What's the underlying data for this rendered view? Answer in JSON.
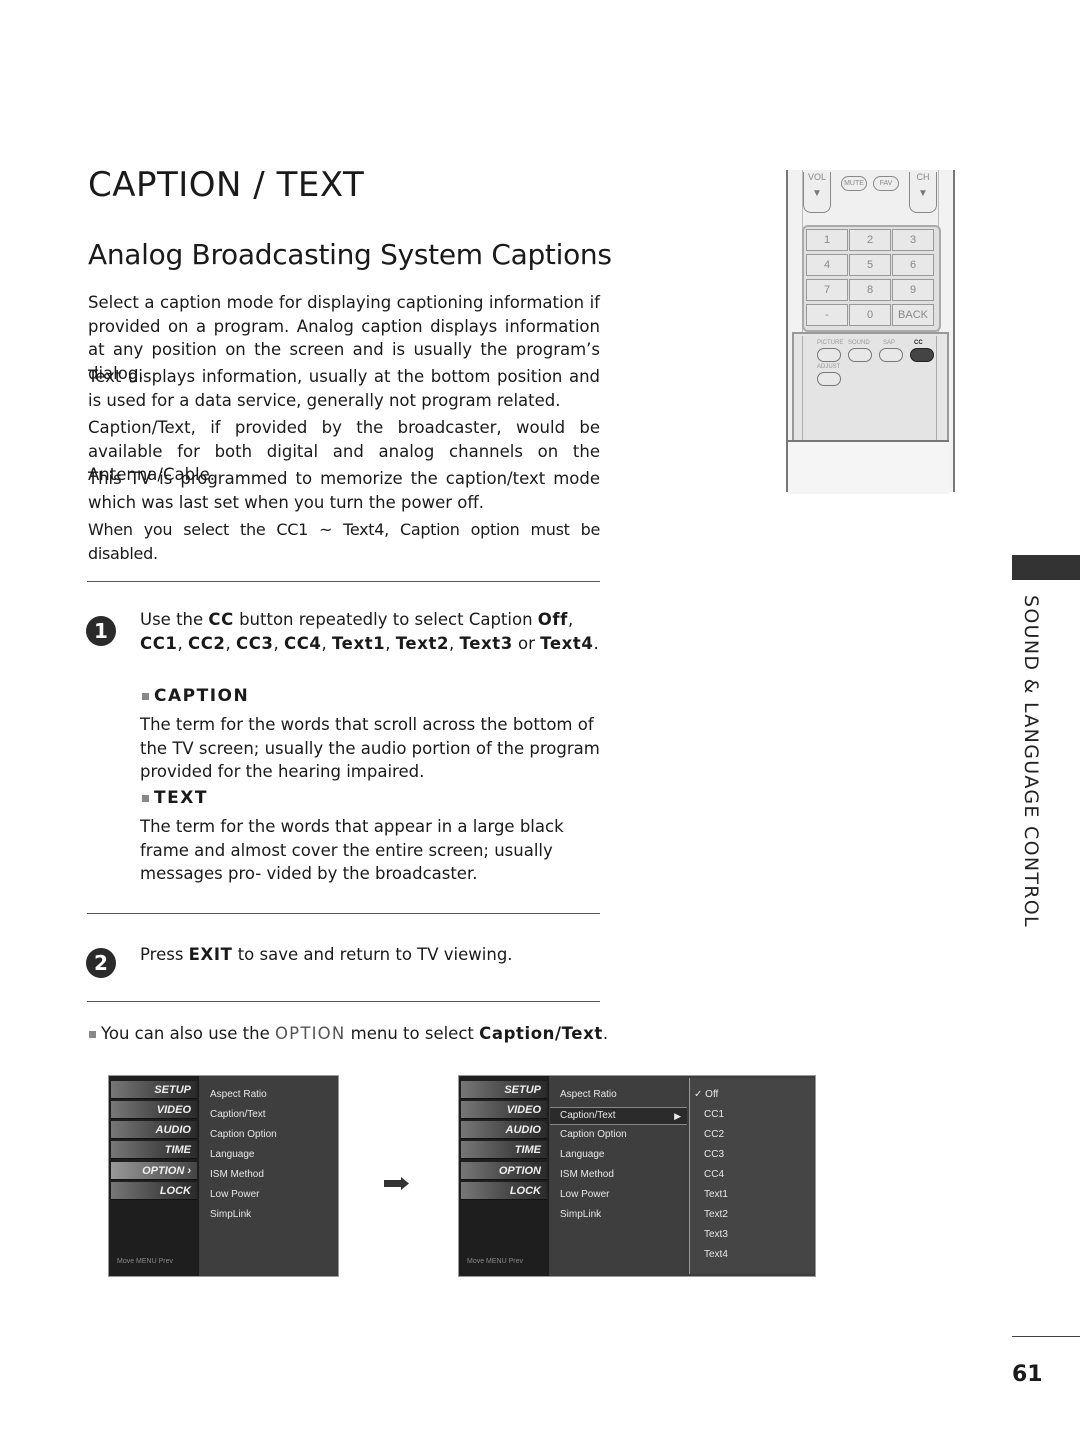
{
  "header": {
    "title": "CAPTION / TEXT",
    "subtitle": "Analog Broadcasting System Captions"
  },
  "intro": [
    "Select a caption mode for displaying captioning information if provided on a program. Analog caption displays information at any position on the screen and is usually the program’s dialog.",
    "Text displays information, usually at the bottom position and is used for a data service, generally not program related.",
    "Caption/Text, if provided by the broadcaster, would be available for both digital and analog channels on the Antenna/Cable.",
    "This TV is programmed to memorize the caption/text mode which was last set when you turn the power off.",
    "When you select the CC1 ~ Text4, Caption option must be disabled."
  ],
  "steps": [
    {
      "number": "1",
      "text_parts": [
        "Use the ",
        "CC",
        " button repeatedly to select Caption ",
        "Off",
        ", ",
        "CC1",
        ", ",
        "CC2",
        ", ",
        "CC3",
        ", ",
        "CC4",
        ", ",
        "Text1",
        ", ",
        "Text2",
        ", ",
        "Text3",
        " or ",
        "Text4",
        "."
      ],
      "subsections": [
        {
          "heading": "CAPTION",
          "body": "The term for the words that scroll across the bottom of the TV screen; usually the audio portion of the program provided for the hearing impaired."
        },
        {
          "heading": "TEXT",
          "body": "The term for the words that appear in a large black frame and almost cover the entire screen; usually messages pro- vided by the broadcaster."
        }
      ]
    },
    {
      "number": "2",
      "text_parts": [
        "Press ",
        "EXIT",
        " to save and return to TV viewing."
      ]
    }
  ],
  "note": {
    "parts": [
      "You can also use the ",
      "OPTION",
      " menu to select ",
      "Caption/Text",
      "."
    ]
  },
  "side_label": "SOUND & LANGUAGE CONTROL",
  "page_number": "61",
  "remote": {
    "top_buttons": [
      "VOL",
      "MUTE",
      "FAV",
      "CH"
    ],
    "keys": [
      "1",
      "2",
      "3",
      "4",
      "5",
      "6",
      "7",
      "8",
      "9",
      "-",
      "0",
      "BACK"
    ],
    "tray_buttons": [
      "PICTURE",
      "SOUND",
      "SAP",
      "CC",
      "ADJUST"
    ],
    "highlighted": "CC"
  },
  "osd": {
    "categories": [
      "SETUP",
      "VIDEO",
      "AUDIO",
      "TIME",
      "OPTION",
      "LOCK"
    ],
    "active_category": "OPTION",
    "footer": "Move   MENU Prev",
    "menu_items": [
      "Aspect Ratio",
      "Caption/Text",
      "Caption Option",
      "Language",
      "ISM Method",
      "Low Power",
      "SimpLink"
    ],
    "selected_item": "Caption/Text",
    "submenu_items": [
      "Off",
      "CC1",
      "CC2",
      "CC3",
      "CC4",
      "Text1",
      "Text2",
      "Text3",
      "Text4"
    ],
    "checked_submenu": "Off",
    "arrow_glyph": "➡",
    "submenu_arrow": "▶",
    "check_glyph": "✓"
  }
}
